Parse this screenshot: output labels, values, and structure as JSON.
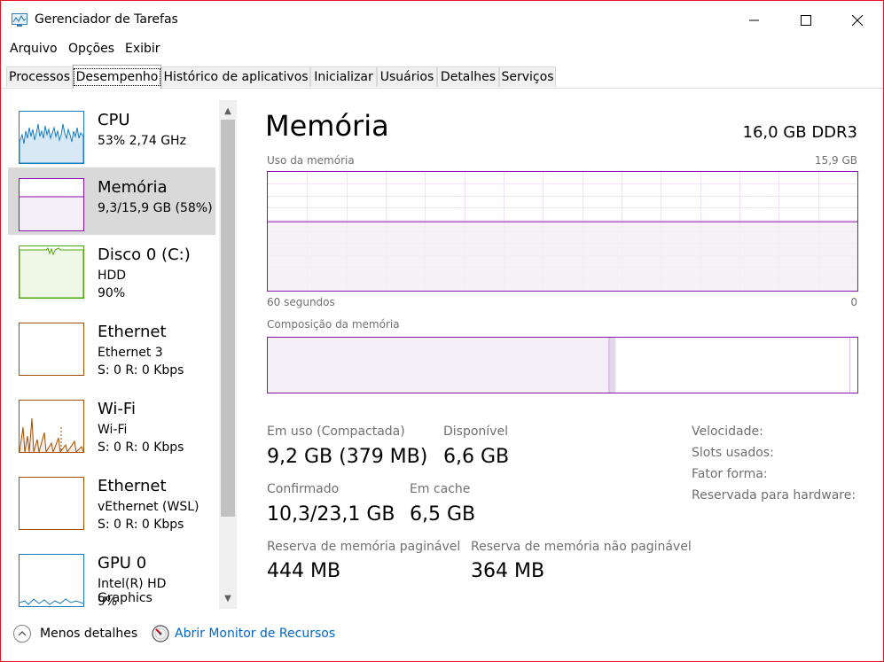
{
  "window": {
    "title": "Gerenciador de Tarefas",
    "frame_color": "#e81123"
  },
  "menu": [
    "Arquivo",
    "Opções",
    "Exibir"
  ],
  "tabs": [
    "Processos",
    "Desempenho",
    "Histórico de aplicativos",
    "Inicializar",
    "Usuários",
    "Detalhes",
    "Serviços"
  ],
  "active_tab": "Desempenho",
  "sidebar": {
    "items": [
      {
        "title": "CPU",
        "line1": "53%  2,74 GHz",
        "line2": "",
        "icon": "cpu-graph",
        "color": "#1a7dbf"
      },
      {
        "title": "Memória",
        "line1": "9,3/15,9 GB (58%)",
        "line2": "",
        "icon": "memory-graph",
        "color": "#8b12ae",
        "selected": true
      },
      {
        "title": "Disco 0 (C:)",
        "line1": "HDD",
        "line2": "90%",
        "icon": "disk-graph",
        "color": "#4da60c"
      },
      {
        "title": "Ethernet",
        "line1": "Ethernet 3",
        "line2": "S: 0 R: 0 Kbps",
        "icon": "ethernet-graph",
        "color": "#a74f01"
      },
      {
        "title": "Wi-Fi",
        "line1": "Wi-Fi",
        "line2": "S: 0 R: 0 Kbps",
        "icon": "wifi-graph",
        "color": "#a74f01"
      },
      {
        "title": "Ethernet",
        "line1": "vEthernet (WSL)",
        "line2": "S: 0 R: 0 Kbps",
        "icon": "ethernet-graph",
        "color": "#a74f01"
      },
      {
        "title": "GPU 0",
        "line1": "Intel(R) HD Graphics",
        "line2": "9%",
        "icon": "gpu-graph",
        "color": "#1a7dbf"
      }
    ]
  },
  "main": {
    "title": "Memória",
    "spec": "16,0 GB DDR3",
    "usage_label": "Uso da memória",
    "usage_max": "15,9 GB",
    "axis_left": "60 segundos",
    "axis_right": "0",
    "usage_fraction": 0.58,
    "composition_label": "Composição da memória",
    "composition": {
      "in_use_fraction": 0.578,
      "modified_fraction": 0.012,
      "free_fraction": 0.41
    },
    "stats": {
      "in_use_label": "Em uso (Compactada)",
      "in_use_value": "9,2 GB (379 MB)",
      "available_label": "Disponível",
      "available_value": "6,6 GB",
      "committed_label": "Confirmado",
      "committed_value": "10,3/23,1 GB",
      "cached_label": "Em cache",
      "cached_value": "6,5 GB",
      "paged_label": "Reserva de memória paginável",
      "paged_value": "444 MB",
      "nonpaged_label": "Reserva de memória não paginável",
      "nonpaged_value": "364 MB"
    },
    "properties": [
      "Velocidade:",
      "Slots usados:",
      "Fator forma:",
      "Reservada para hardware:"
    ],
    "accent": "#8b12ae"
  },
  "footer": {
    "less_details": "Menos detalhes",
    "resource_monitor": "Abrir Monitor de Recursos"
  }
}
